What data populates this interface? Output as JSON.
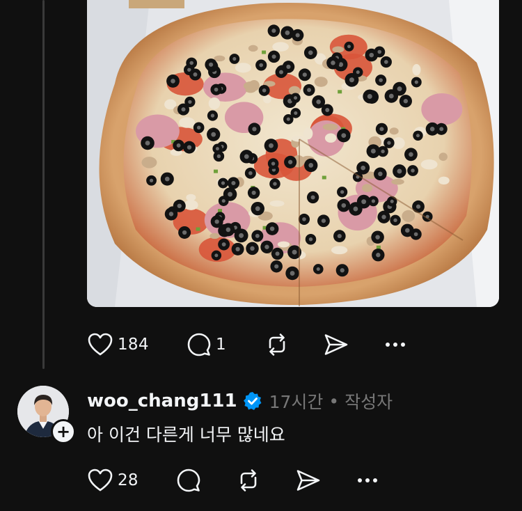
{
  "post": {
    "image_alt": "pizza photo",
    "actions": {
      "like_icon": "heart-icon",
      "like_count": "184",
      "reply_icon": "comment-icon",
      "reply_count": "1",
      "repost_icon": "repost-icon",
      "share_icon": "send-icon",
      "more_icon": "more-icon"
    }
  },
  "reply": {
    "username": "woo_chang111",
    "verified_icon": "verified-badge-icon",
    "time": "17시간",
    "separator": "•",
    "author_tag": "작성자",
    "text": "아 이건 다른게 너무 많네요",
    "follow_icon": "plus-icon",
    "actions": {
      "like_count": "28"
    }
  },
  "colors": {
    "background": "#101010",
    "text": "#f3f5f7",
    "muted": "#777777",
    "verified": "#0095f6",
    "thread_line": "#3a3a3a"
  }
}
